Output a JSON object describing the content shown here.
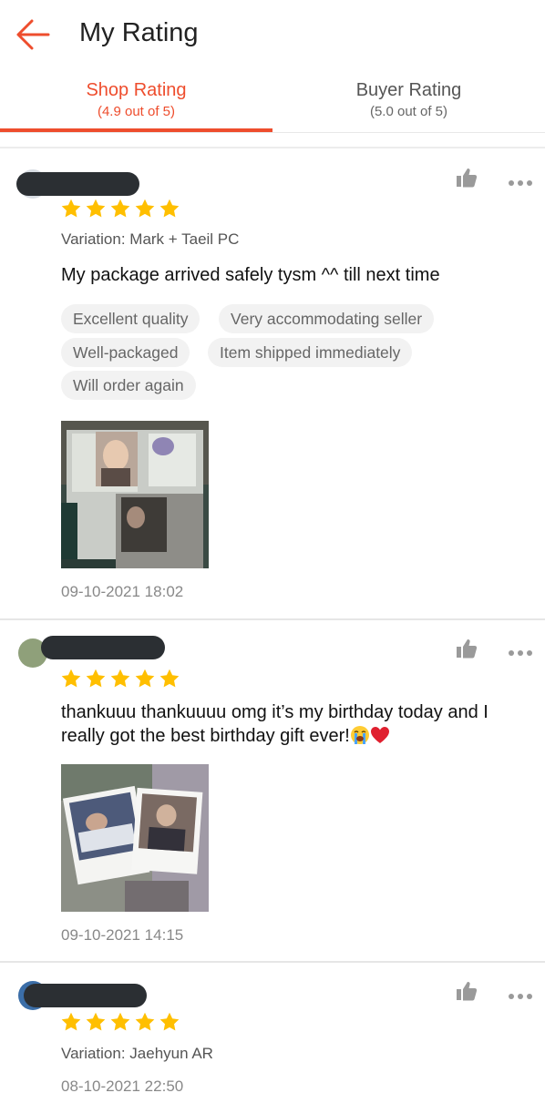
{
  "header": {
    "title": "My Rating",
    "back_icon": "back-arrow-icon"
  },
  "tabs": [
    {
      "label": "Shop Rating",
      "sub": "(4.9 out of 5)",
      "active": true
    },
    {
      "label": "Buyer Rating",
      "sub": "(5.0 out of 5)",
      "active": false
    }
  ],
  "colors": {
    "accent": "#ee4d2d",
    "star": "#ffbf00",
    "tag_bg": "#f2f2f2"
  },
  "reviews": [
    {
      "stars": 5,
      "variation": "Variation: Mark + Taeil PC",
      "comment": "My package arrived safely tysm ^^ till next time",
      "tags": [
        "Excellent quality",
        "Very accommodating seller",
        "Well-packaged",
        "Item shipped immediately",
        "Will order again"
      ],
      "photo": "photocard-binder-photo",
      "time": "09-10-2021 18:02"
    },
    {
      "stars": 5,
      "comment": "thankuuu thankuuuu omg it’s my birthday today and I really got the best birthday gift ever!",
      "emojis": [
        "loudly-crying-face-emoji",
        "red-heart-emoji"
      ],
      "photo": "polaroid-photos-photo",
      "time": "09-10-2021 14:15"
    },
    {
      "stars": 5,
      "variation": "Variation: Jaehyun AR",
      "time": "08-10-2021 22:50"
    }
  ]
}
